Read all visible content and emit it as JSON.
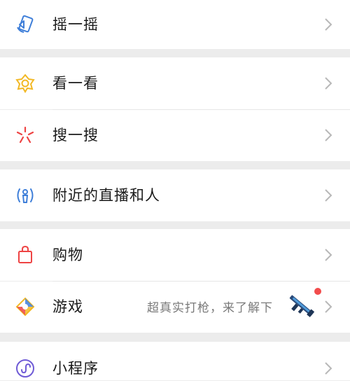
{
  "menu": {
    "shake": {
      "label": "摇一摇",
      "icon": "shake-icon"
    },
    "look": {
      "label": "看一看",
      "icon": "look-icon"
    },
    "search": {
      "label": "搜一搜",
      "icon": "search-sparkle-icon"
    },
    "nearby": {
      "label": "附近的直播和人",
      "icon": "nearby-person-icon"
    },
    "shopping": {
      "label": "购物",
      "icon": "shopping-bag-icon"
    },
    "games": {
      "label": "游戏",
      "icon": "games-diamond-icon",
      "promo_text": "超真实打枪，来了解下",
      "promo_image": "rifle-thumbnail",
      "badge": "red-dot"
    },
    "mini_programs": {
      "label": "小程序",
      "icon": "mini-program-icon"
    }
  },
  "colors": {
    "background": "#ececec",
    "row": "#ffffff",
    "text": "#1a1a1a",
    "subtext": "#7a7a7a",
    "chevron": "#b8b8b8",
    "badge": "#f24c4c",
    "blue": "#3f7fd9",
    "yellow": "#f2b824",
    "red": "#ee4444",
    "purple": "#6f5bd6"
  }
}
